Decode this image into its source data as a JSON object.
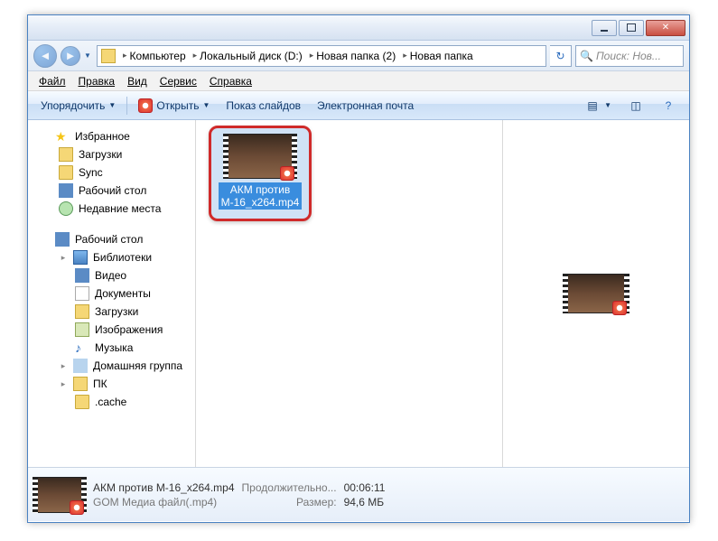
{
  "breadcrumb": {
    "items": [
      {
        "label": "Компьютер"
      },
      {
        "label": "Локальный диск (D:)"
      },
      {
        "label": "Новая папка (2)"
      },
      {
        "label": "Новая папка"
      }
    ]
  },
  "search": {
    "placeholder": "Поиск: Нов..."
  },
  "menu": {
    "file": "Файл",
    "edit": "Правка",
    "view": "Вид",
    "tools": "Сервис",
    "help": "Справка"
  },
  "toolbar": {
    "organize": "Упорядочить",
    "open": "Открыть",
    "slideshow": "Показ слайдов",
    "email": "Электронная почта"
  },
  "sidebar": {
    "favorites": "Избранное",
    "downloads": "Загрузки",
    "sync": "Sync",
    "desktop": "Рабочий стол",
    "recent": "Недавние места",
    "desktop2": "Рабочий стол",
    "libraries": "Библиотеки",
    "video": "Видео",
    "documents": "Документы",
    "downloads2": "Загрузки",
    "pictures": "Изображения",
    "music": "Музыка",
    "homegroup": "Домашняя группа",
    "pc": "ПК",
    "cache": ".cache"
  },
  "file": {
    "name_line1": "АКМ против",
    "name_line2": "М-16_x264.mp4",
    "full_name": "АКМ против М-16_x264.mp4"
  },
  "details": {
    "name": "АКМ против М-16_x264.mp4",
    "type": "GOM Медиа файл(.mp4)",
    "duration_label": "Продолжительно...",
    "duration": "00:06:11",
    "size_label": "Размер:",
    "size": "94,6 МБ"
  }
}
